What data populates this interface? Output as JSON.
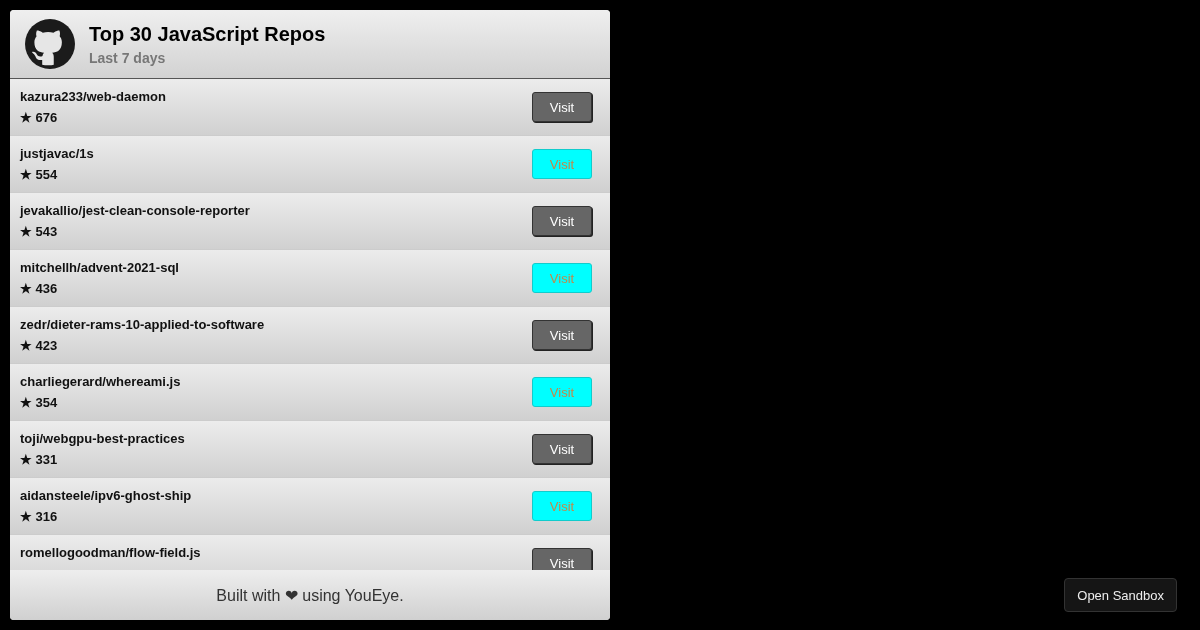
{
  "header": {
    "title": "Top 30 JavaScript Repos",
    "subtitle": "Last 7 days"
  },
  "repos": [
    {
      "name": "kazura233/web-daemon",
      "stars_text": "★ 676",
      "button": "Visit",
      "highlighted": false
    },
    {
      "name": "justjavac/1s",
      "stars_text": "★ 554",
      "button": "Visit",
      "highlighted": true
    },
    {
      "name": "jevakallio/jest-clean-console-reporter",
      "stars_text": "★ 543",
      "button": "Visit",
      "highlighted": false
    },
    {
      "name": "mitchellh/advent-2021-sql",
      "stars_text": "★ 436",
      "button": "Visit",
      "highlighted": true
    },
    {
      "name": "zedr/dieter-rams-10-applied-to-software",
      "stars_text": "★ 423",
      "button": "Visit",
      "highlighted": false
    },
    {
      "name": "charliegerard/whereami.js",
      "stars_text": "★ 354",
      "button": "Visit",
      "highlighted": true
    },
    {
      "name": "toji/webgpu-best-practices",
      "stars_text": "★ 331",
      "button": "Visit",
      "highlighted": false
    },
    {
      "name": "aidansteele/ipv6-ghost-ship",
      "stars_text": "★ 316",
      "button": "Visit",
      "highlighted": true
    },
    {
      "name": "romellogoodman/flow-field.js",
      "button": "Visit",
      "highlighted": false
    }
  ],
  "footer": {
    "text": "Built with ❤ using YouEye."
  },
  "sandbox_button": "Open Sandbox"
}
